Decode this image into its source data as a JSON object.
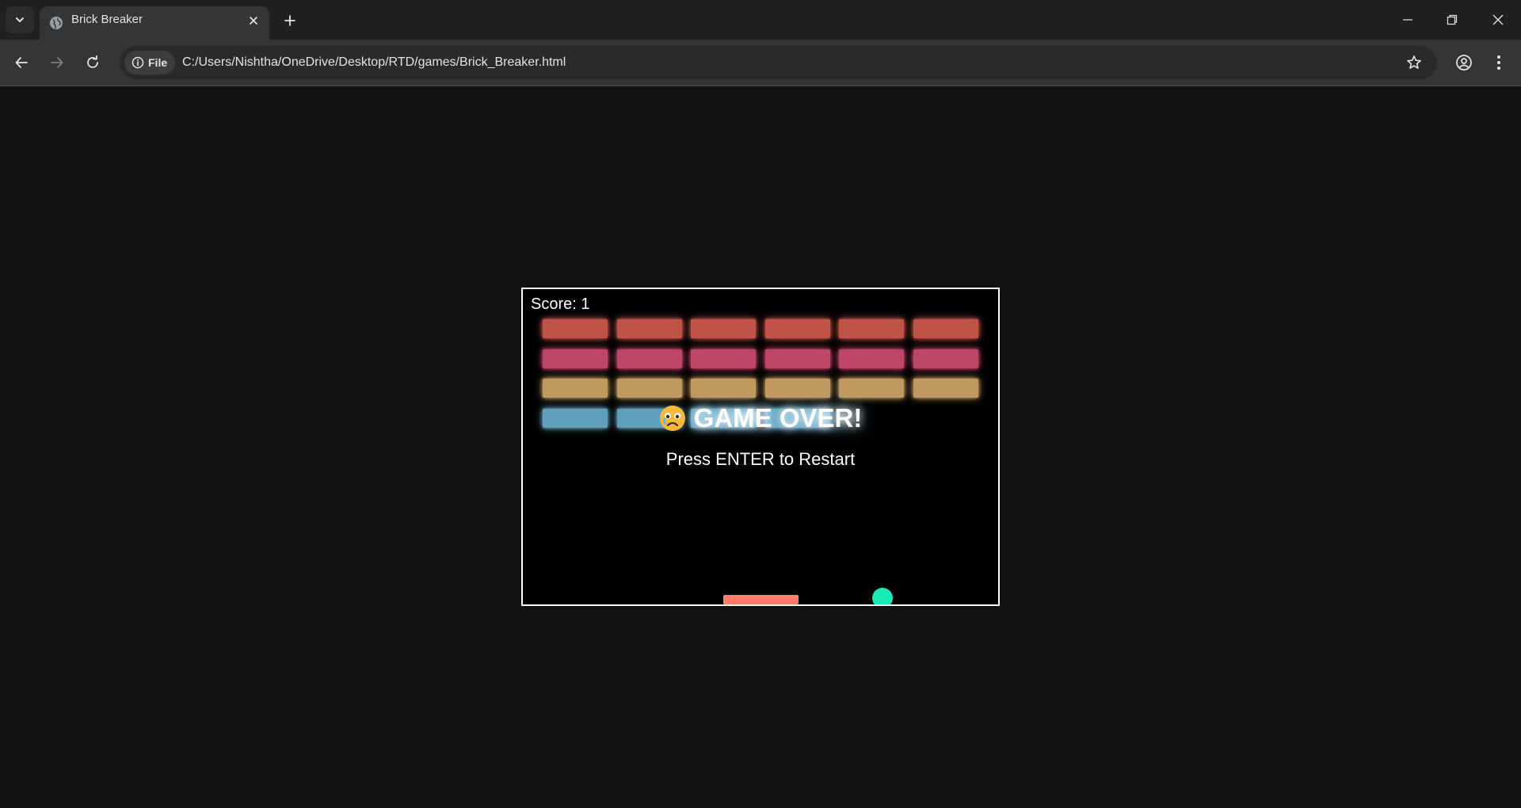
{
  "browser": {
    "tab_title": "Brick Breaker",
    "file_chip_label": "File",
    "url": "C:/Users/Nishtha/OneDrive/Desktop/RTD/games/Brick_Breaker.html"
  },
  "game": {
    "score_text": "Score: 1",
    "game_over_text": "GAME OVER!",
    "restart_text": "Press ENTER to Restart",
    "brick_rows": [
      {
        "color": "#ff6f61",
        "bricks": [
          true,
          true,
          true,
          true,
          true,
          true
        ]
      },
      {
        "color": "#ff5c8a",
        "bricks": [
          true,
          true,
          true,
          true,
          true,
          true
        ]
      },
      {
        "color": "#ffcc80",
        "bricks": [
          true,
          true,
          true,
          true,
          true,
          true
        ]
      },
      {
        "color": "#81d4fa",
        "bricks": [
          true,
          true,
          true,
          true,
          false,
          false
        ]
      }
    ],
    "paddle_color": "#ff7c6a",
    "ball_color": "#1de9b6",
    "background_color": "#000000"
  }
}
